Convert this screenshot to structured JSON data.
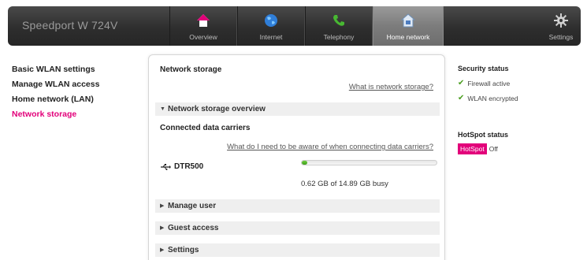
{
  "app": {
    "brand": "Speedport W 724V"
  },
  "nav": {
    "tabs": [
      {
        "label": "Overview",
        "icon": "home-icon"
      },
      {
        "label": "Internet",
        "icon": "globe-icon"
      },
      {
        "label": "Telephony",
        "icon": "phone-icon"
      },
      {
        "label": "Home network",
        "icon": "home-network-icon",
        "active": true
      }
    ],
    "settings": {
      "label": "Settings",
      "icon": "gear-icon"
    }
  },
  "sidebar": {
    "items": [
      {
        "label": "Basic WLAN settings"
      },
      {
        "label": "Manage WLAN access"
      },
      {
        "label": "Home network (LAN)"
      },
      {
        "label": "Network storage",
        "active": true
      }
    ]
  },
  "main": {
    "title": "Network storage",
    "help_link": "What is network storage?",
    "overview": {
      "header": "Network storage overview",
      "subhead": "Connected data carriers",
      "help_link": "What do I need to be aware of when connecting data carriers?",
      "device": {
        "name": "DTR500",
        "usage_text": "0.62 GB of 14.89 GB busy",
        "usage_fraction": 0.042
      }
    },
    "sections": [
      {
        "label": "Manage user"
      },
      {
        "label": "Guest access"
      },
      {
        "label": "Settings"
      }
    ]
  },
  "status": {
    "security_heading": "Security status",
    "firewall": "Firewall active",
    "wlan": "WLAN encrypted",
    "hotspot_heading": "HotSpot status",
    "hotspot_badge": "HotSpot",
    "hotspot_state": "Off"
  },
  "colors": {
    "accent": "#e2007a",
    "check": "#4a9e1f",
    "progress": "#3d9d1a"
  }
}
